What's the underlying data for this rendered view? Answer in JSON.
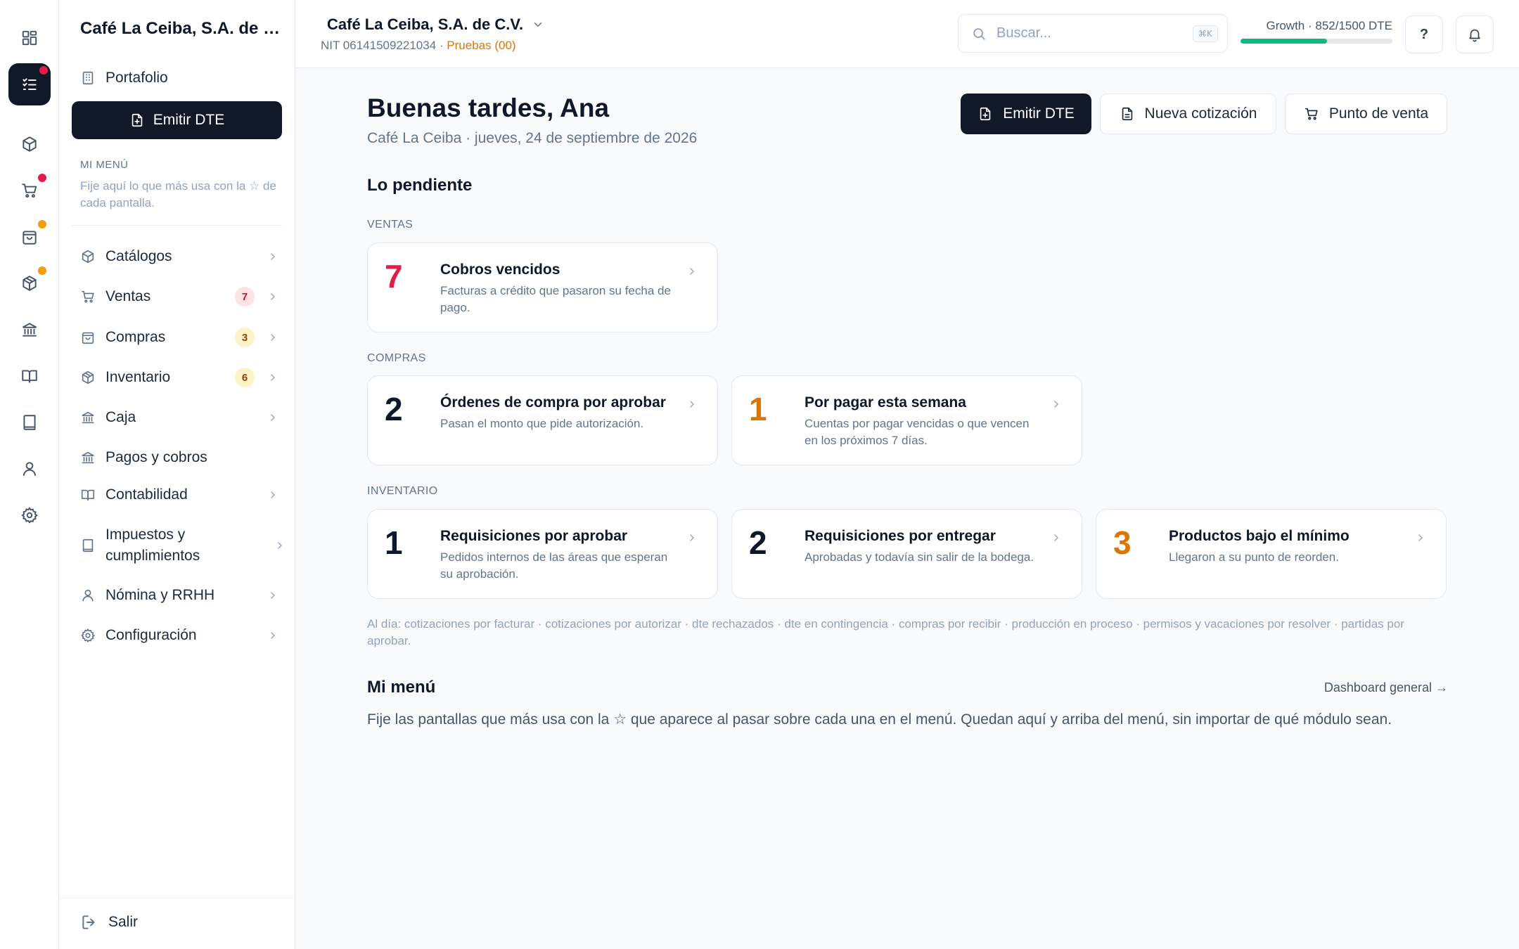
{
  "rail": {
    "items": [
      {
        "icon": "grid-icon"
      },
      {
        "icon": "checklist-icon",
        "active": true,
        "dot": "#e11d48"
      },
      {
        "icon": "box-icon"
      },
      {
        "icon": "cart-icon",
        "dot": "#e11d48"
      },
      {
        "icon": "bag-icon",
        "dot": "#f59e0b"
      },
      {
        "icon": "package-icon",
        "dot": "#f59e0b"
      },
      {
        "icon": "bank-icon"
      },
      {
        "icon": "book-open-icon"
      },
      {
        "icon": "ledger-book-icon"
      },
      {
        "icon": "user-icon"
      },
      {
        "icon": "gear-icon"
      }
    ]
  },
  "sidebar": {
    "company": "Café La Ceiba, S.A. de C.V.",
    "portfolio": "Portafolio",
    "emit_label": "Emitir DTE",
    "mymenu_label": "MI MENÚ",
    "mymenu_hint": "Fije aquí lo que más usa con la ☆ de cada pantalla.",
    "items": [
      {
        "label": "Catálogos",
        "icon": "box-icon",
        "chevron": true
      },
      {
        "label": "Ventas",
        "icon": "cart-icon",
        "badge": "7",
        "badge_bg": "#fde2e4",
        "badge_fg": "#be123c",
        "chevron": true
      },
      {
        "label": "Compras",
        "icon": "bag-icon",
        "badge": "3",
        "badge_bg": "#fef3c7",
        "badge_fg": "#92400e",
        "chevron": true
      },
      {
        "label": "Inventario",
        "icon": "package-icon",
        "badge": "6",
        "badge_bg": "#fef3c7",
        "badge_fg": "#92400e",
        "chevron": true
      },
      {
        "label": "Caja",
        "icon": "bank-icon",
        "chevron": true
      },
      {
        "label": "Pagos y cobros",
        "icon": "bank-icon",
        "chevron": false
      },
      {
        "label": "Contabilidad",
        "icon": "book-open-icon",
        "chevron": true
      },
      {
        "label": "Impuestos y cumplimientos",
        "icon": "ledger-book-icon",
        "chevron": true
      },
      {
        "label": "Nómina y RRHH",
        "icon": "user-icon",
        "chevron": true
      },
      {
        "label": "Configuración",
        "icon": "gear-icon",
        "chevron": true
      }
    ],
    "logout": "Salir"
  },
  "header": {
    "org_name": "Café La Ceiba, S.A. de C.V.",
    "nit": "NIT 06141509221034 · ",
    "env": "Pruebas (00)",
    "search_placeholder": "Buscar...",
    "search_kbd": "⌘K",
    "plan_label": "Growth · 852/1500 DTE",
    "plan_used": 852,
    "plan_total": 1500,
    "help_label": "?"
  },
  "main": {
    "greeting": "Buenas tardes, Ana",
    "subline": "Café La Ceiba · jueves, 24 de septiembre de 2026",
    "actions": {
      "emit": "Emitir DTE",
      "quote": "Nueva cotización",
      "pos": "Punto de venta"
    },
    "pending_title": "Lo pendiente",
    "groups": {
      "ventas": "VENTAS",
      "compras": "COMPRAS",
      "inventario": "INVENTARIO"
    },
    "cards": {
      "cobros": {
        "count": "7",
        "color": "#e11d48",
        "title": "Cobros vencidos",
        "desc": "Facturas a crédito que pasaron su fecha de pago."
      },
      "ordenes": {
        "count": "2",
        "color": "#0f172a",
        "title": "Órdenes de compra por aprobar",
        "desc": "Pasan el monto que pide autorización."
      },
      "porpagar": {
        "count": "1",
        "color": "#d97706",
        "title": "Por pagar esta semana",
        "desc": "Cuentas por pagar vencidas o que vencen en los próximos 7 días."
      },
      "reqaprobar": {
        "count": "1",
        "color": "#0f172a",
        "title": "Requisiciones por aprobar",
        "desc": "Pedidos internos de las áreas que esperan su aprobación."
      },
      "reqentregar": {
        "count": "2",
        "color": "#0f172a",
        "title": "Requisiciones por entregar",
        "desc": "Aprobadas y todavía sin salir de la bodega."
      },
      "bajominimo": {
        "count": "3",
        "color": "#d97706",
        "title": "Productos bajo el mínimo",
        "desc": "Llegaron a su punto de reorden."
      }
    },
    "all_good": "Al día: cotizaciones por facturar · cotizaciones por autorizar · dte rechazados · dte en contingencia · compras por recibir · producción en proceso · permisos y vacaciones por resolver · partidas por aprobar.",
    "mymenu_title": "Mi menú",
    "dashboard_link": "Dashboard general →",
    "mymenu_body": "Fije las pantallas que más usa con la ☆ que aparece al pasar sobre cada una en el menú. Quedan aquí y arriba del menú, sin importar de qué módulo sean."
  }
}
